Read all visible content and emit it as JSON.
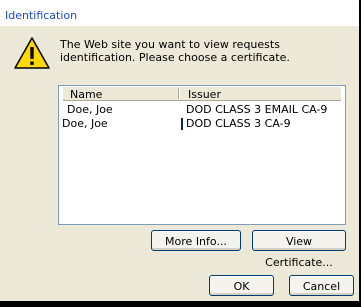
{
  "dialog": {
    "title": "Identification",
    "message": "The Web site you want to view requests identification. Please choose a certificate."
  },
  "columns": {
    "name": "Name",
    "issuer": "Issuer"
  },
  "certificates": [
    {
      "name": "Doe, Joe",
      "issuer": "DOD CLASS 3 EMAIL CA-9"
    },
    {
      "name": "Doe, Joe",
      "issuer": "DOD CLASS 3 CA-9"
    }
  ],
  "buttons": {
    "more_info": "More Info...",
    "view_certificate": "View Certificate...",
    "ok": "OK",
    "cancel": "Cancel"
  },
  "icons": {
    "warning": "warning-icon"
  },
  "colors": {
    "title_text": "#1c4ccc",
    "dialog_bg": "#ece9d8",
    "selection_bar": "#0a246a"
  }
}
